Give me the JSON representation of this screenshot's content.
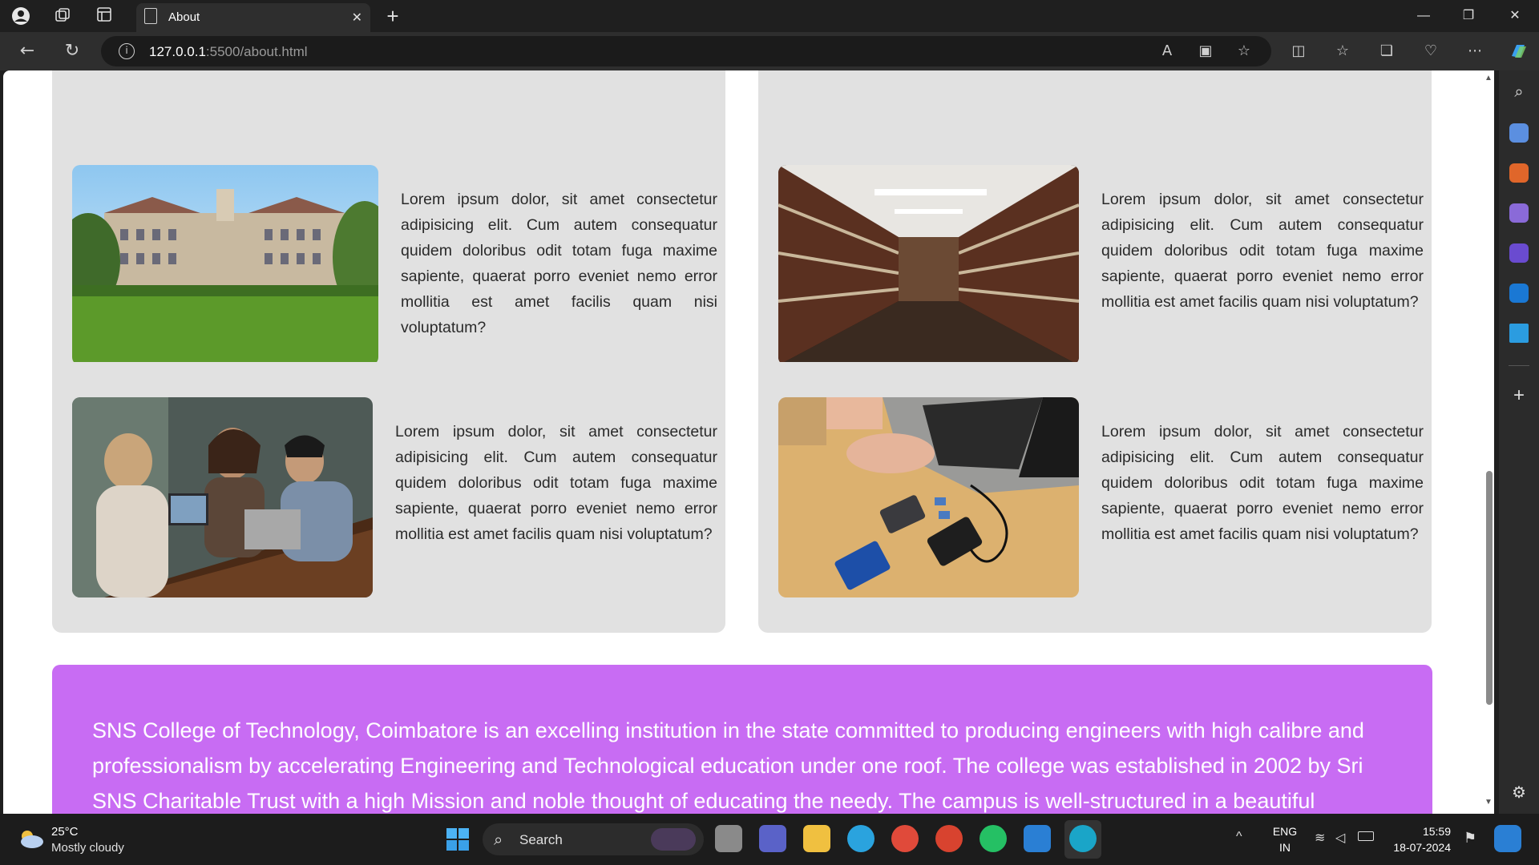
{
  "browser": {
    "tab_title": "About",
    "address_host": "127.0.0.1",
    "address_path": ":5500/about.html"
  },
  "page": {
    "cards": [
      {
        "text": "Lorem ipsum dolor, sit amet consectetur adipisicing elit. Cum autem consequatur quidem doloribus odit totam fuga maxime sapiente, quaerat porro eveniet nemo error mollitia est amet facilis quam nisi voluptatum?"
      },
      {
        "text": "Lorem ipsum dolor, sit amet consectetur adipisicing elit. Cum autem consequatur quidem doloribus odit totam fuga maxime sapiente, quaerat porro eveniet nemo error mollitia est amet facilis quam nisi voluptatum?"
      },
      {
        "text": "Lorem ipsum dolor, sit amet consectetur adipisicing elit. Cum autem consequatur quidem doloribus odit totam fuga maxime sapiente, quaerat porro eveniet nemo error mollitia est amet facilis quam nisi voluptatum?"
      },
      {
        "text": "Lorem ipsum dolor, sit amet consectetur adipisicing elit. Cum autem consequatur quidem doloribus odit totam fuga maxime sapiente, quaerat porro eveniet nemo error mollitia est amet facilis quam nisi voluptatum?"
      }
    ],
    "banner_text": "SNS College of Technology, Coimbatore is an excelling institution in the state committed to producing engineers with high calibre and professionalism by accelerating Engineering and Technological education under one roof. The college was established in 2002 by Sri SNS Charitable Trust with a high Mission and noble thought of educating the needy. The campus is well-structured in a beautiful"
  },
  "taskbar": {
    "weather_temp": "25°C",
    "weather_desc": "Mostly cloudy",
    "search_label": "Search",
    "lang_top": "ENG",
    "lang_bottom": "IN",
    "time": "15:59",
    "date": "18-07-2024"
  },
  "colors": {
    "banner": "#c86cf3",
    "card": "#e1e1e1"
  }
}
